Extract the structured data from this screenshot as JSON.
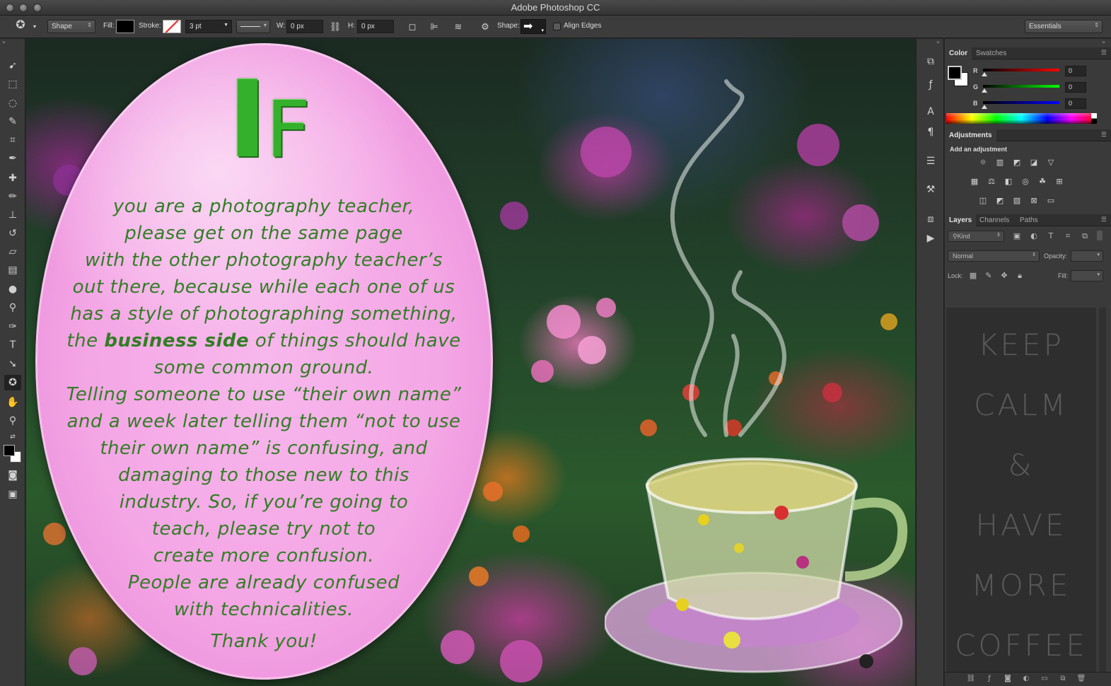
{
  "app": {
    "title": "Adobe Photoshop CC"
  },
  "options_bar": {
    "tool_mode": "Shape",
    "fill_label": "Fill:",
    "stroke_label": "Stroke:",
    "stroke_width": "3 pt",
    "w_label": "W:",
    "w_value": "0 px",
    "h_label": "H:",
    "h_value": "0 px",
    "shape_label": "Shape:",
    "align_edges_label": "Align Edges",
    "workspace": "Essentials"
  },
  "canvas": {
    "big_i": "I",
    "big_f": "F",
    "lines": [
      "you are a photography teacher,",
      "please get on the same page",
      "with the other photography teacher’s",
      "out there, because while each one of us",
      "has a style of photographing something,"
    ],
    "line6_pre": "the ",
    "line6_bold": "business side",
    "line6_post": " of things should have",
    "lines2": [
      "some common ground.",
      "Telling someone to use “their own name”",
      "and a week later telling them “not to use",
      "their own name” is confusing, and",
      "damaging to those new to this",
      "industry. So, if you’re going to",
      "teach, please try not to",
      "create more confusion.",
      "People are already confused",
      "with technicalities."
    ],
    "thanks": "Thank you!",
    "colors": {
      "bubble": "#f4a6e5",
      "text": "#317e23",
      "letters": "#35b02d"
    }
  },
  "color_panel": {
    "tabs": [
      "Color",
      "Swatches"
    ],
    "r_label": "R",
    "r_value": "0",
    "g_label": "G",
    "g_value": "0",
    "b_label": "B",
    "b_value": "0"
  },
  "adjustments_panel": {
    "tab": "Adjustments",
    "heading": "Add an adjustment"
  },
  "layers_panel": {
    "tabs": [
      "Layers",
      "Channels",
      "Paths"
    ],
    "kind": "Kind",
    "blend_mode": "Normal",
    "opacity_label": "Opacity:",
    "lock_label": "Lock:",
    "fill_label": "Fill:",
    "preview_lines": [
      "KEEP",
      "CALM",
      "&",
      "HAVE",
      "MORE",
      "COFFEE"
    ]
  }
}
